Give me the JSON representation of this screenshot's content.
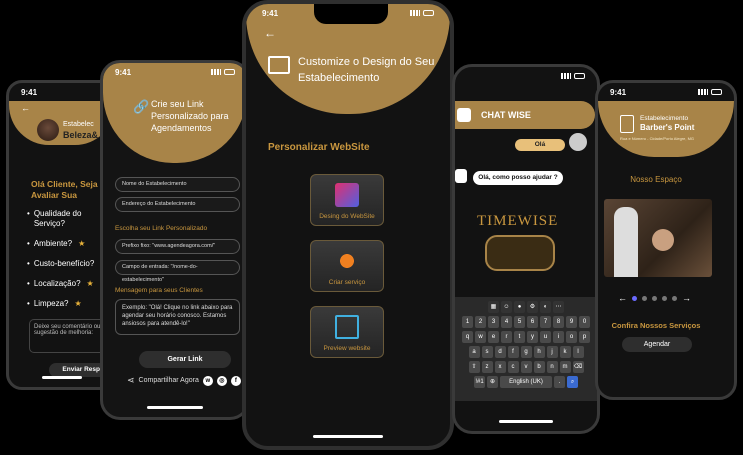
{
  "phone1": {
    "time": "9:41",
    "est_label": "Estabelec",
    "name": "Beleza&",
    "greeting": "Olá Cliente, Seja Be Venha Avaliar Sua",
    "questions": [
      "Qualidade do Serviço?",
      "Ambiente?",
      "Custo-benefício?",
      "Localização?",
      "Limpeza?"
    ],
    "comment_placeholder": "Deixe seu comentário ou sugestão de melhoria:",
    "send_button": "Enviar Respos"
  },
  "phone2": {
    "time": "9:41",
    "title": "Crie seu Link Personalizado para Agendamentos",
    "field_name": "Nome do Estabelecimento",
    "field_address": "Endereço do Estabelecimento",
    "link_section": "Escolha seu Link Personalizado",
    "prefix_field": "Prefixo fixo: \"www.agendeagora.com/\"",
    "entry_field": "Campo de entrada: \"/nome-do-estabelecimento\"",
    "msg_section": "Mensagem para seus Clientes",
    "msg_example": "Exemplo: \"Olá! Clique no link abaixo para agendar seu horário conosco. Estamos ansiosos para atendê-lo!\"",
    "generate_button": "Gerar Link",
    "share_label": "Compartilhar Agora"
  },
  "phone3": {
    "time": "9:41",
    "title": "Customize o Design do Seu Estabelecimento",
    "section": "Personalizar WebSite",
    "options": [
      "Desing do WebSite",
      "Criar serviço",
      "Preview website"
    ]
  },
  "phone4": {
    "title": "CHAT WISE",
    "user_msg": "Olá",
    "bot_msg": "Olá, como posso ajudar ?",
    "brand": "TIMEWISE",
    "keys_row1": [
      "1",
      "2",
      "3",
      "4",
      "5",
      "6",
      "7",
      "8",
      "9",
      "0"
    ],
    "keys_row2": [
      "q",
      "w",
      "e",
      "r",
      "t",
      "y",
      "u",
      "i",
      "o",
      "p"
    ],
    "keys_row3": [
      "a",
      "s",
      "d",
      "f",
      "g",
      "h",
      "j",
      "k",
      "l"
    ],
    "keys_row4": [
      "z",
      "x",
      "c",
      "v",
      "b",
      "n",
      "m"
    ],
    "space_label": "English (UK)",
    "sym_key": "!#1"
  },
  "phone5": {
    "time": "9:41",
    "est_label": "Estabelecimento",
    "name": "Barber's Point",
    "address": "Rua e Número - Cidade/Porto Alegre, MG",
    "section": "Nosso Espaço",
    "confirm": "Confira Nossos Serviços",
    "book_button": "Agendar"
  },
  "colors": {
    "gold": "#a88448",
    "gold_text": "#c9973f"
  }
}
